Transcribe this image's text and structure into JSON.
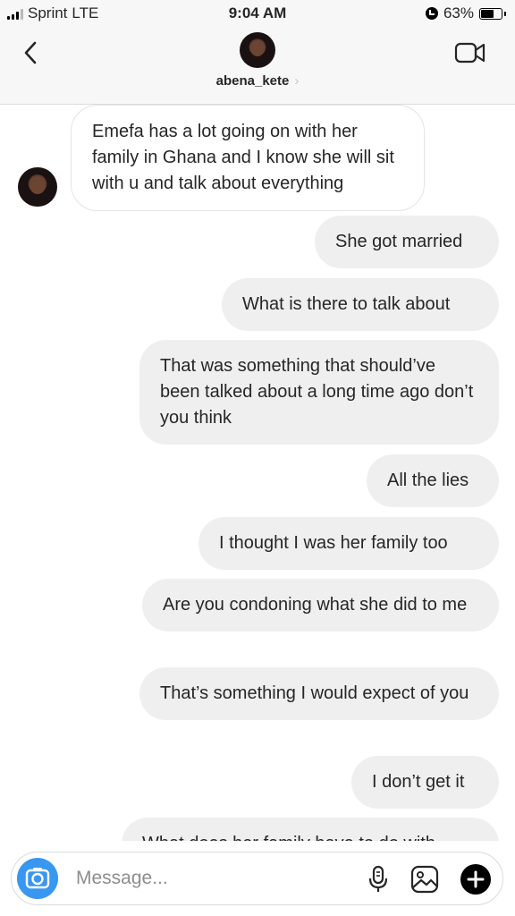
{
  "status_bar": {
    "carrier": "Sprint",
    "network": "LTE",
    "time": "9:04 AM",
    "battery": "63%",
    "battery_level": 0.63,
    "icons": [
      "signal-icon",
      "alarm-icon",
      "battery-icon"
    ]
  },
  "header": {
    "username": "abena_kete",
    "chevron": "›",
    "icons": [
      "back-chevron-icon",
      "video-camera-icon"
    ]
  },
  "thread": {
    "messages": [
      {
        "direction": "in",
        "text": "Emefa has a lot going on with her family in Ghana and I know she will sit with u and talk about everything"
      },
      {
        "direction": "out",
        "text": "She got married"
      },
      {
        "direction": "out",
        "text": "What is there to talk about"
      },
      {
        "direction": "out",
        "text": "That was something that should’ve been talked about a long time ago don’t you think"
      },
      {
        "direction": "out",
        "text": "All the lies"
      },
      {
        "direction": "out",
        "text": "I thought I was her family too"
      },
      {
        "direction": "out",
        "text": "Are you condoning what she did to me"
      },
      {
        "direction": "out",
        "text": "That’s something I would expect of you"
      },
      {
        "direction": "out",
        "text": "I don’t get it"
      },
      {
        "direction": "out",
        "text": "What does her family have to do with"
      }
    ]
  },
  "composer": {
    "placeholder": "Message...",
    "icons": [
      "camera-icon",
      "microphone-icon",
      "gallery-icon",
      "plus-icon"
    ],
    "accent": "#3897f0"
  }
}
